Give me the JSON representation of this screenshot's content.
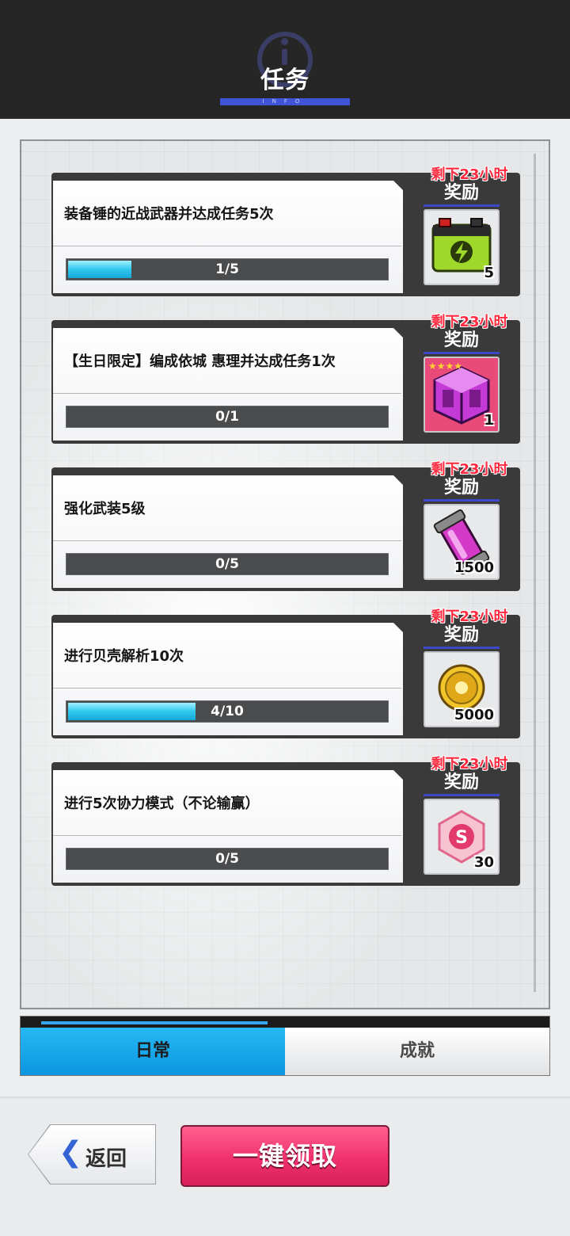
{
  "header": {
    "title": "任务",
    "subtitle": "INFO"
  },
  "missions": [
    {
      "task": "装备锤的近战武器并达成任务5次",
      "progress_text": "1/5",
      "progress": 0.2,
      "timer": "剩下23小时",
      "reward_label": "奖励",
      "reward_item": "battery-icon",
      "reward_qty": "5"
    },
    {
      "task": "【生日限定】编成依城 惠理并达成任务1次",
      "progress_text": "0/1",
      "progress": 0.0,
      "timer": "剩下23小时",
      "reward_label": "奖励",
      "reward_item": "crate-icon",
      "reward_qty": "1"
    },
    {
      "task": "强化武装5级",
      "progress_text": "0/5",
      "progress": 0.0,
      "timer": "剩下23小时",
      "reward_label": "奖励",
      "reward_item": "capsule-icon",
      "reward_qty": "1500"
    },
    {
      "task": "进行贝壳解析10次",
      "progress_text": "4/10",
      "progress": 0.4,
      "timer": "剩下23小时",
      "reward_label": "奖励",
      "reward_item": "gold-coin-icon",
      "reward_qty": "5000"
    },
    {
      "task": "进行5次协力模式（不论输赢）",
      "progress_text": "0/5",
      "progress": 0.0,
      "timer": "剩下23小时",
      "reward_label": "奖励",
      "reward_item": "s-gem-icon",
      "reward_qty": "30"
    }
  ],
  "tabs": {
    "daily": "日常",
    "achievement": "成就"
  },
  "buttons": {
    "back": "返回",
    "claim_all": "一键领取"
  },
  "colors": {
    "accent": "#1aa6ea",
    "timer": "#ff2a3f",
    "claim": "#f0316e"
  }
}
